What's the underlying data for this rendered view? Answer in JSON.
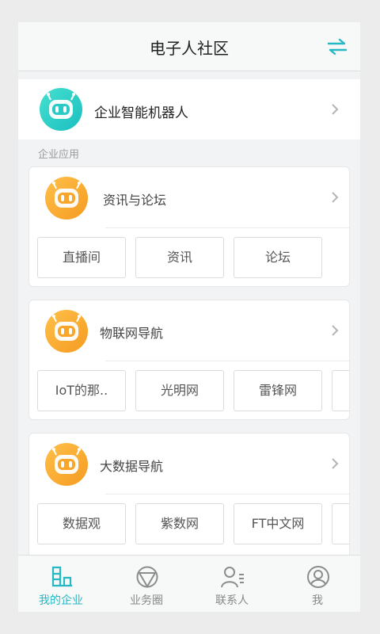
{
  "header": {
    "title": "电子人社区",
    "switch_icon": "swap-arrows-icon",
    "accent": "#27b9c3"
  },
  "robot": {
    "label": "企业智能机器人",
    "icon": "robot-icon",
    "color": "#2ccac6"
  },
  "section_title": "企业应用",
  "cards": [
    {
      "title": "资讯与论坛",
      "icon": "robot-icon",
      "chips": [
        "直播间",
        "资讯",
        "论坛"
      ]
    },
    {
      "title": "物联网导航",
      "icon": "robot-icon",
      "chips": [
        "IoT的那..",
        "光明网",
        "雷锋网",
        ""
      ]
    },
    {
      "title": "大数据导航",
      "icon": "robot-icon",
      "chips": [
        "数据观",
        "紫数网",
        "FT中文网",
        ""
      ]
    }
  ],
  "tabs": [
    {
      "label": "我的企业",
      "icon": "enterprise-icon",
      "active": true
    },
    {
      "label": "业务圈",
      "icon": "circle-triangle-icon",
      "active": false
    },
    {
      "label": "联系人",
      "icon": "contacts-icon",
      "active": false
    },
    {
      "label": "我",
      "icon": "profile-icon",
      "active": false
    }
  ]
}
